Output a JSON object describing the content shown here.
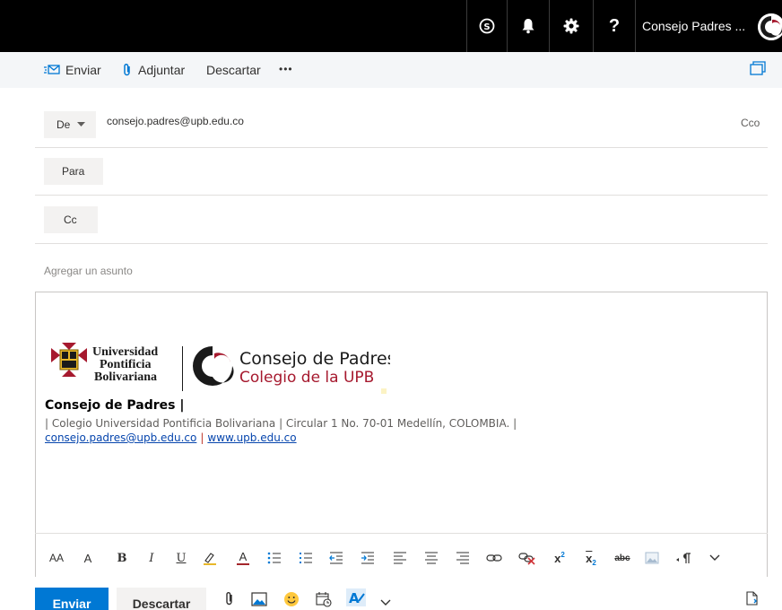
{
  "topbar": {
    "skype_label": "S",
    "help_label": "?",
    "user_name": "Consejo Padres ..."
  },
  "commands": {
    "send": "Enviar",
    "attach": "Adjuntar",
    "discard": "Descartar",
    "more": "•••"
  },
  "compose": {
    "from_label": "De",
    "from_address": "consejo.padres@upb.edu.co",
    "bcc_label": "Cco",
    "to_label": "Para",
    "cc_label": "Cc",
    "subject_placeholder": "Agregar un asunto"
  },
  "signature": {
    "logo_university_line1": "Universidad",
    "logo_university_line2": "Pontificia",
    "logo_university_line3": "Bolivariana",
    "logo_council_title": "Consejo de Padres",
    "logo_council_subtitle": "Colegio de la UPB",
    "name": "Consejo de Padres |",
    "address": "| Colegio Universidad Pontificia Bolivariana | Circular 1 No. 70-01 Medellín, COLOMBIA. |",
    "email": "consejo.padres@upb.edu.co",
    "separator": "|",
    "website": "www.upb.edu.co"
  },
  "format_toolbar": {
    "font_size": "AA",
    "grow_font": "A",
    "bold": "B",
    "italic": "I",
    "underline": "U",
    "font_color": "A",
    "superscript": "x",
    "subscript": "x",
    "strikethrough": "abc"
  },
  "bottom": {
    "send": "Enviar",
    "discard": "Descartar"
  },
  "colors": {
    "accent": "#0078d4",
    "brand_red": "#a6192e",
    "topbar": "#000000"
  }
}
